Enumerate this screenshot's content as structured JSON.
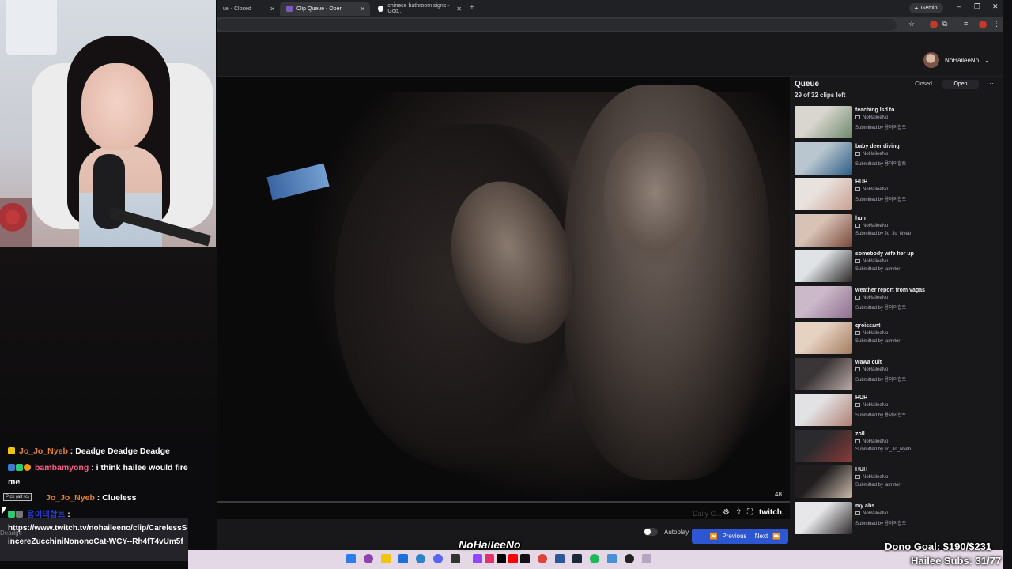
{
  "browser": {
    "tabs": [
      {
        "label": "ue - Closed"
      },
      {
        "label": "Clip Queue - Open"
      },
      {
        "label": "chinese bathroom signs - Goo..."
      }
    ],
    "new_tab": "+",
    "gemini_label": "Gemini",
    "win_min": "–",
    "win_max": "❐",
    "win_close": "✕"
  },
  "header": {
    "username": "NoHaileeNo",
    "dropdown": "⌄"
  },
  "player": {
    "timestamp": "48",
    "progress_fraction": 0.0,
    "settings_icon": "⚙",
    "share_icon": "⇪",
    "fullscreen_icon": "⛶",
    "brand": "twitch",
    "watermark": "Daily C..."
  },
  "controls": {
    "autoplay_label": "Autoplay",
    "previous_label": "Previous",
    "next_label": "Next"
  },
  "queue": {
    "title": "Queue",
    "count": "29 of 32 clips left",
    "closed_label": "Closed",
    "open_label": "Open",
    "more": "···",
    "clips": [
      {
        "title": "teaching lsd to",
        "channel": "NoHaileeNo",
        "submitted": "Submitted by 용이의합트",
        "thumb": [
          "#d9d6cf",
          "#6f8a6d"
        ]
      },
      {
        "title": "baby deer diving",
        "channel": "NoHaileeNo",
        "submitted": "Submitted by 용이의합트",
        "thumb": [
          "#b9c6cf",
          "#2f5e86"
        ]
      },
      {
        "title": "HUH",
        "channel": "NoHaileeNo",
        "submitted": "Submitted by 용이의합트",
        "thumb": [
          "#e8e2de",
          "#caa192"
        ]
      },
      {
        "title": "huh",
        "channel": "NoHaileeNo",
        "submitted": "Submitted by Jo_Jo_Nyeb",
        "thumb": [
          "#d8c2b5",
          "#7a4b3c"
        ]
      },
      {
        "title": "somebody wife her up",
        "channel": "NoHaileeNo",
        "submitted": "Submitted by iamvtor",
        "thumb": [
          "#dfe3e6",
          "#2d2a2a"
        ]
      },
      {
        "title": "weather report from vagas",
        "channel": "NoHaileeNo",
        "submitted": "Submitted by 용이의합트",
        "thumb": [
          "#cbb8c9",
          "#8d6f8f"
        ]
      },
      {
        "title": "qroissant",
        "channel": "NoHaileeNo",
        "submitted": "Submitted by iamvtor",
        "thumb": [
          "#e6d2c0",
          "#a47d62"
        ]
      },
      {
        "title": "wawa cult",
        "channel": "NoHaileeNo",
        "submitted": "Submitted by 용이의합트",
        "thumb": [
          "#3a3536",
          "#b9a9a7"
        ]
      },
      {
        "title": "HUH",
        "channel": "NoHaileeNo",
        "submitted": "Submitted by 용이의합트",
        "thumb": [
          "#e2e1e3",
          "#b07f74"
        ]
      },
      {
        "title": "zoll",
        "channel": "NoHaileeNo",
        "submitted": "Submitted by Jo_Jo_Nyeb",
        "thumb": [
          "#2b2a2d",
          "#8a3b3b"
        ]
      },
      {
        "title": "HUH",
        "channel": "NoHaileeNo",
        "submitted": "Submitted by iamvtor",
        "thumb": [
          "#1f1d1e",
          "#c9b7a8"
        ]
      },
      {
        "title": "my abs",
        "channel": "NoHaileeNo",
        "submitted": "Submitted by 용이의합트",
        "thumb": [
          "#e7e7e9",
          "#2f2b2c"
        ]
      }
    ]
  },
  "chat": {
    "lines": [
      {
        "name": "Jo_Jo_Nyeb",
        "sep": ":",
        "msg": "Deadge Deadge Deadge"
      },
      {
        "name": "bambamyong",
        "sep": ":",
        "msg": "i think hailee would fire me"
      },
      {
        "name": "Jo_Jo_Nyeb",
        "sep": ":",
        "msg": "Clueless"
      },
      {
        "name": "용이의합트",
        "sep": ":",
        "msg": ""
      }
    ],
    "link": "https://www.twitch.tv/nohaileeno/clip/CarelessSincereZucchiniNononoCat-WCY--Rh4fT4vUm5f",
    "tiny_label": "Pick (alt+c)",
    "side_label": "Deadge"
  },
  "overlay": {
    "logo": "NoHaileeNo",
    "dono_goal": "Dono Goal: $190/$231",
    "subs": "Hailee Subs: 31/77"
  },
  "colors": {
    "accent": "#2d56d3",
    "page_bg": "#18181b",
    "taskbar": "#e4d7e6"
  }
}
